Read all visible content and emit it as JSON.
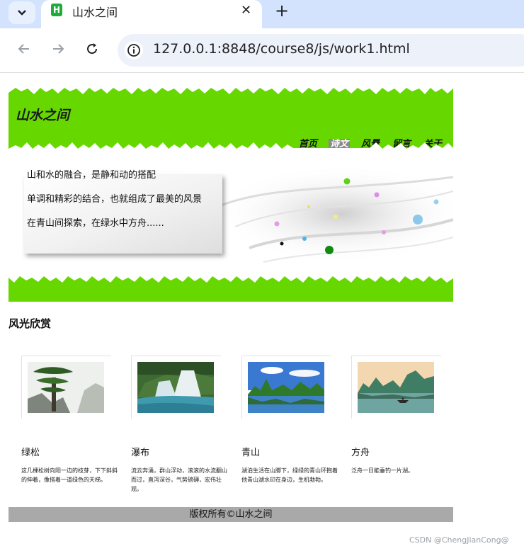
{
  "browser": {
    "tab_title": "山水之间",
    "favicon_letter": "H",
    "url": "127.0.0.1:8848/course8/js/work1.html"
  },
  "site": {
    "title": "山水之间",
    "nav": [
      {
        "label": "首页",
        "active": false
      },
      {
        "label": "诗文",
        "active": true
      },
      {
        "label": "风景",
        "active": false
      },
      {
        "label": "留言",
        "active": false
      },
      {
        "label": "关于",
        "active": false
      }
    ],
    "banner_lines": [
      "山和水的融合，是静和动的搭配",
      "单调和精彩的结合，也就组成了最美的风景",
      "在青山间探索，在绿水中方舟......"
    ],
    "section_title": "风光欣赏",
    "cards": [
      {
        "title": "绿松",
        "desc": "这几棵松树向阳一边的枝芽，下下斜斜的伸着，像搭着一道绿色的天梯。"
      },
      {
        "title": "瀑布",
        "desc": "流云奔涌，群山浮动，滚滚的水流翻山而过，直泻深谷，气势磅礴，宏伟壮观。"
      },
      {
        "title": "青山",
        "desc": "湖泊生活在山脚下，绿绿的青山环抱着他青山湖水印在身边，生机勃勃。"
      },
      {
        "title": "方舟",
        "desc": "泛舟一日能垂钓一片湖。"
      }
    ],
    "footer": "版权所有©山水之间"
  },
  "watermark": "CSDN @ChengJianCong@",
  "colors": {
    "header_green": "#66d800",
    "tab_strip": "#d3e3fd",
    "footer_gray": "#a9a9a9"
  }
}
